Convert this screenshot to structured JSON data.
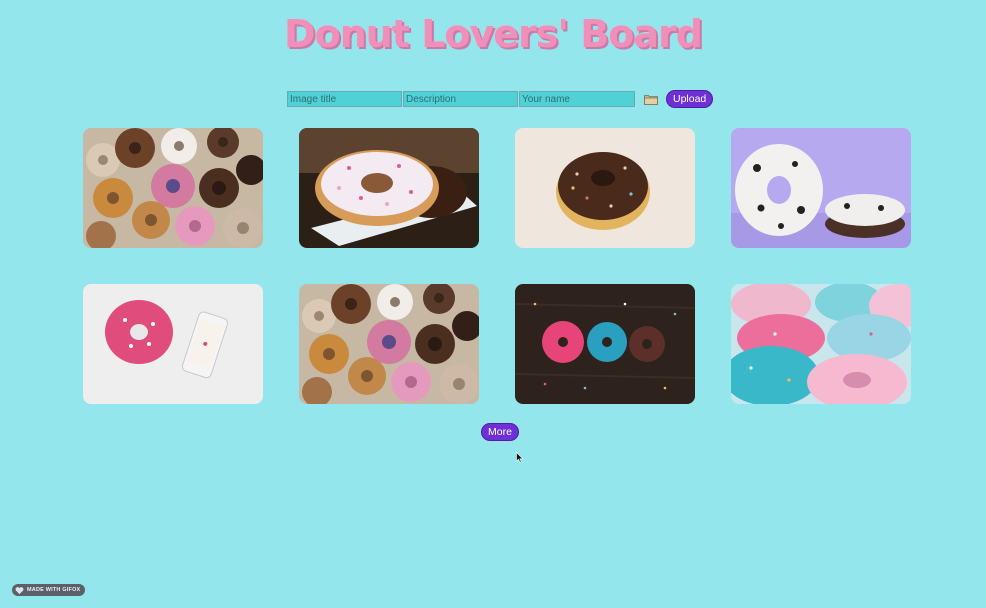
{
  "header": {
    "title": "Donut Lovers' Board"
  },
  "upload": {
    "title_placeholder": "Image title",
    "description_placeholder": "Description",
    "name_placeholder": "Your name",
    "upload_label": "Upload"
  },
  "gallery": {
    "items": [
      {
        "icon": "assorted-donuts-image"
      },
      {
        "icon": "pink-sprinkle-donut-on-plate-image"
      },
      {
        "icon": "chocolate-sprinkle-donut-image"
      },
      {
        "icon": "cookies-and-cream-donuts-image"
      },
      {
        "icon": "pink-donut-and-phone-image"
      },
      {
        "icon": "assorted-donuts-image"
      },
      {
        "icon": "three-donuts-on-wood-image"
      },
      {
        "icon": "colorful-glazed-donuts-image"
      }
    ],
    "more_label": "More"
  },
  "footer": {
    "badge_label": "MADE WITH GIFOX"
  },
  "colors": {
    "background": "#93e6eb",
    "title": "#f08fb8",
    "button": "#6f2fd6",
    "input": "#4fd1d6"
  }
}
